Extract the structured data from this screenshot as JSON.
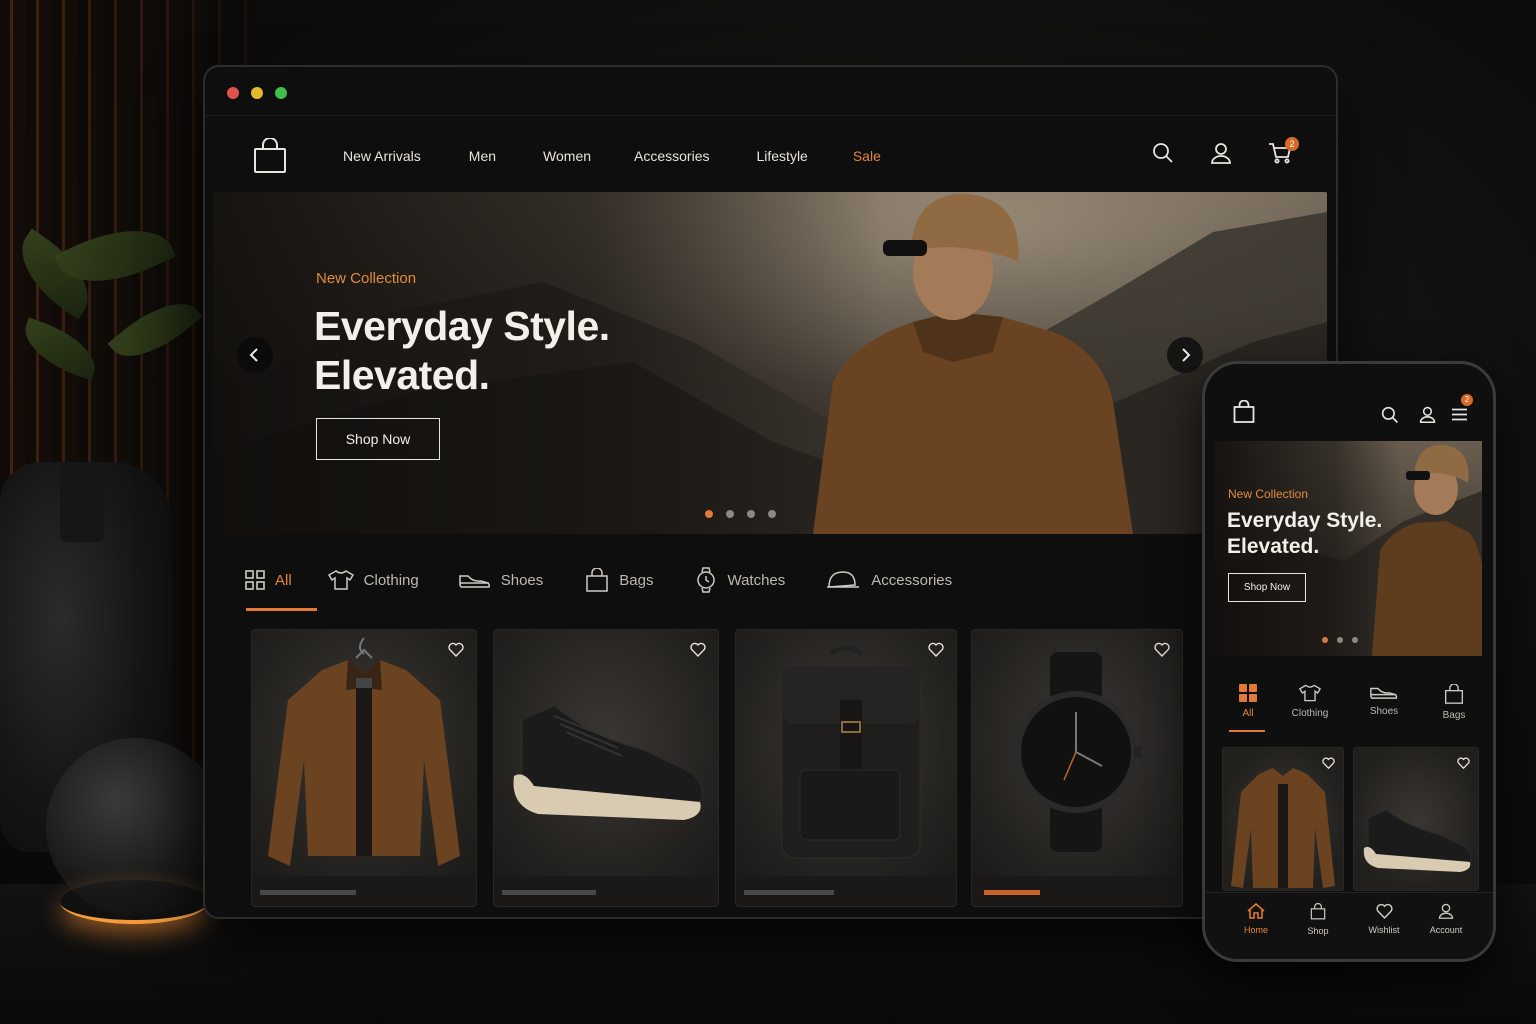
{
  "desktop": {
    "nav": {
      "links": [
        "New Arrivals",
        "Men",
        "Women",
        "Accessories",
        "Lifestyle"
      ],
      "sale": "Sale",
      "cart_count": "2"
    },
    "hero": {
      "kicker": "New Collection",
      "title": "Everyday Style.\nElevated.",
      "cta": "Shop Now",
      "slides_total": 4,
      "active_slide": 1
    },
    "categories": [
      "All",
      "Clothing",
      "Shoes",
      "Bags",
      "Watches",
      "Accessories"
    ],
    "active_category": "All",
    "products": [
      {
        "item": "jacket",
        "favorite": false,
        "accent": false
      },
      {
        "item": "sneaker",
        "favorite": false,
        "accent": false
      },
      {
        "item": "backpack",
        "favorite": false,
        "accent": false
      },
      {
        "item": "watch",
        "favorite": false,
        "accent": true
      }
    ]
  },
  "mobile": {
    "cart_count": "2",
    "hero": {
      "kicker": "New Collection",
      "title": "Everyday Style.\nElevated.",
      "cta": "Shop Now",
      "slides_total": 3,
      "active_slide": 1
    },
    "categories": [
      "All",
      "Clothing",
      "Shoes",
      "Bags"
    ],
    "active_category": "All",
    "tabbar": [
      "Home",
      "Shop",
      "Wishlist",
      "Account"
    ],
    "active_tab": "Home"
  },
  "colors": {
    "accent": "#e07a34",
    "background": "#0e0e0e",
    "text": "#e9e6e1"
  }
}
